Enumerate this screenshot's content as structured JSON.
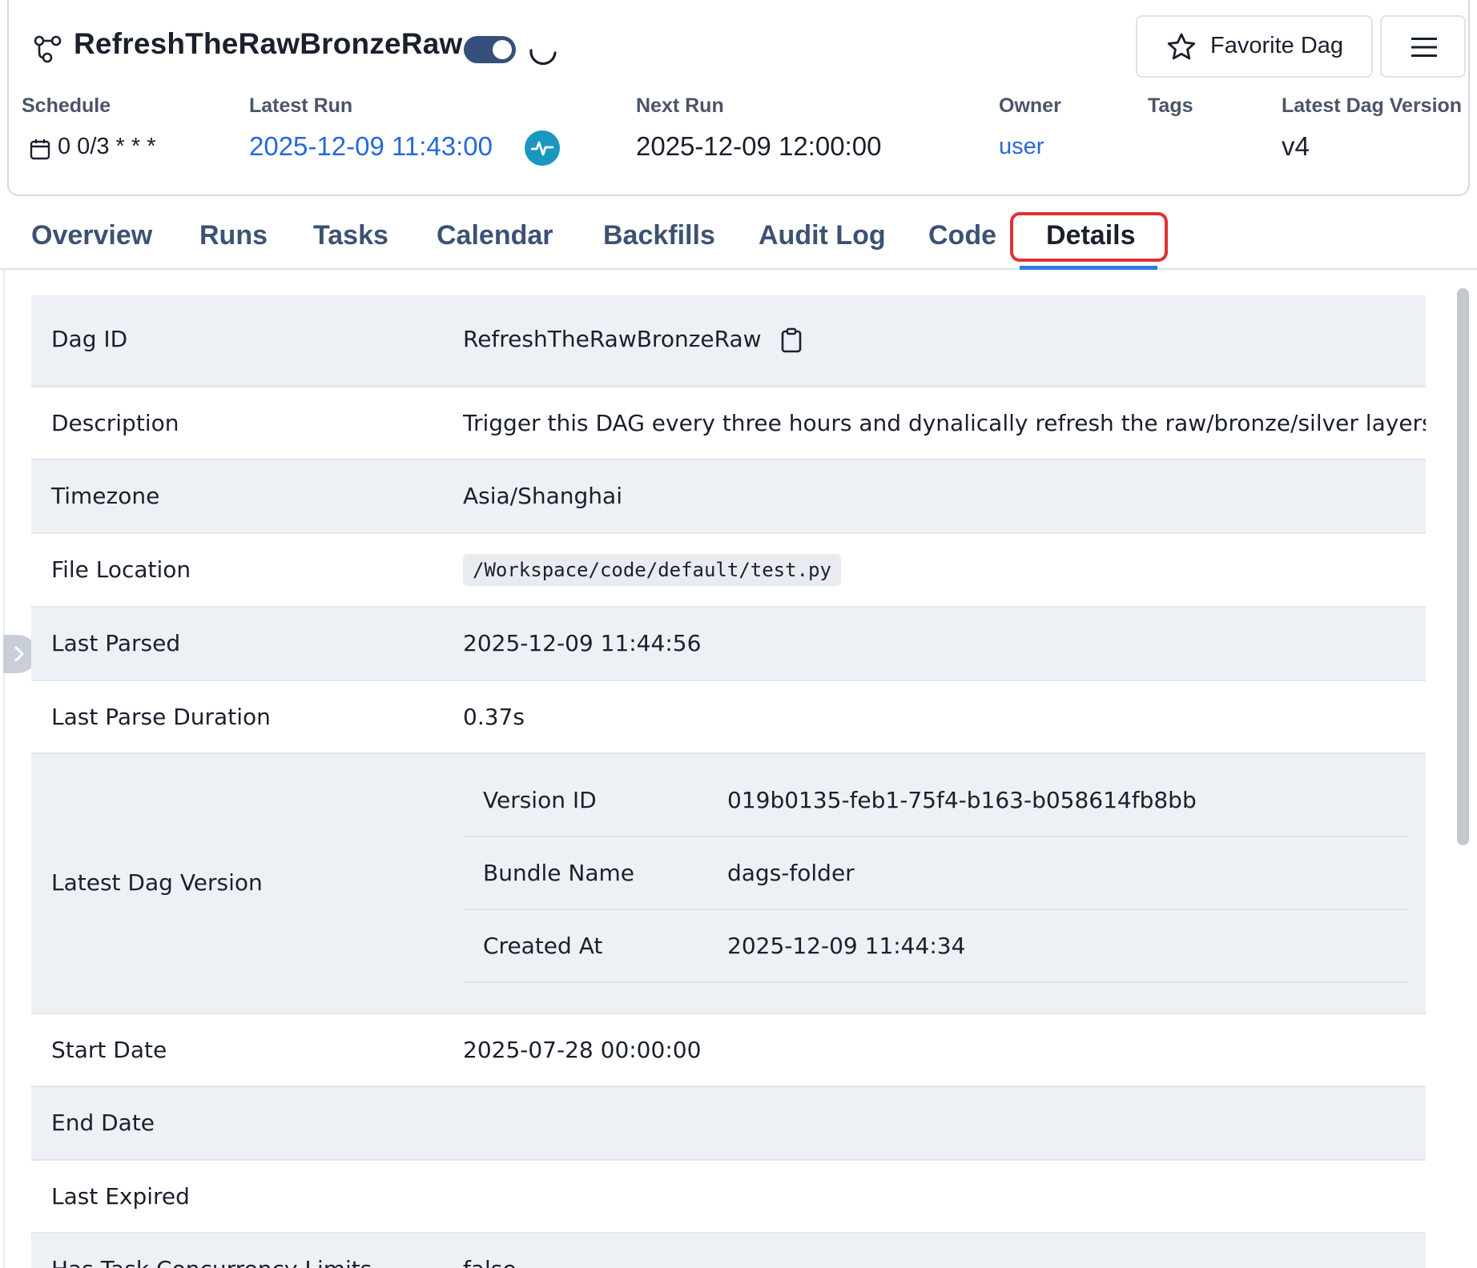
{
  "header": {
    "dag_title": "RefreshTheRawBronzeRaw",
    "dag_enabled": true,
    "favorite_label": "Favorite Dag",
    "meta": {
      "schedule_label": "Schedule",
      "schedule_value": "0 0/3 * * *",
      "latest_run_label": "Latest Run",
      "latest_run_value": "2025-12-09 11:43:00",
      "next_run_label": "Next Run",
      "next_run_value": "2025-12-09 12:00:00",
      "owner_label": "Owner",
      "owner_value": "user",
      "tags_label": "Tags",
      "latest_version_label": "Latest Dag Version",
      "latest_version_value": "v4"
    }
  },
  "tabs": [
    "Overview",
    "Runs",
    "Tasks",
    "Calendar",
    "Backfills",
    "Audit Log",
    "Code",
    "Details"
  ],
  "active_tab": "Details",
  "details": {
    "dag_id_label": "Dag ID",
    "dag_id_value": "RefreshTheRawBronzeRaw",
    "description_label": "Description",
    "description_value": "Trigger this DAG every three hours and dynalically refresh the raw/bronze/silver layers",
    "timezone_label": "Timezone",
    "timezone_value": "Asia/Shanghai",
    "file_location_label": "File Location",
    "file_location_value": "/Workspace/code/default/test.py",
    "last_parsed_label": "Last Parsed",
    "last_parsed_value": "2025-12-09 11:44:56",
    "last_parse_duration_label": "Last Parse Duration",
    "last_parse_duration_value": "0.37s",
    "latest_dag_version_label": "Latest Dag Version",
    "version": {
      "version_id_label": "Version ID",
      "version_id_value": "019b0135-feb1-75f4-b163-b058614fb8bb",
      "bundle_name_label": "Bundle Name",
      "bundle_name_value": "dags-folder",
      "created_at_label": "Created At",
      "created_at_value": "2025-12-09 11:44:34"
    },
    "start_date_label": "Start Date",
    "start_date_value": "2025-07-28 00:00:00",
    "end_date_label": "End Date",
    "last_expired_label": "Last Expired",
    "concurrency_label": "Has Task Concurrency Limits",
    "concurrency_value": "false"
  },
  "colors": {
    "accent_blue": "#2868d8",
    "tab_underline": "#2e7ce0",
    "highlight_red": "#e03131",
    "toggle_on": "#35507a",
    "pulse_teal": "#1997c0"
  }
}
